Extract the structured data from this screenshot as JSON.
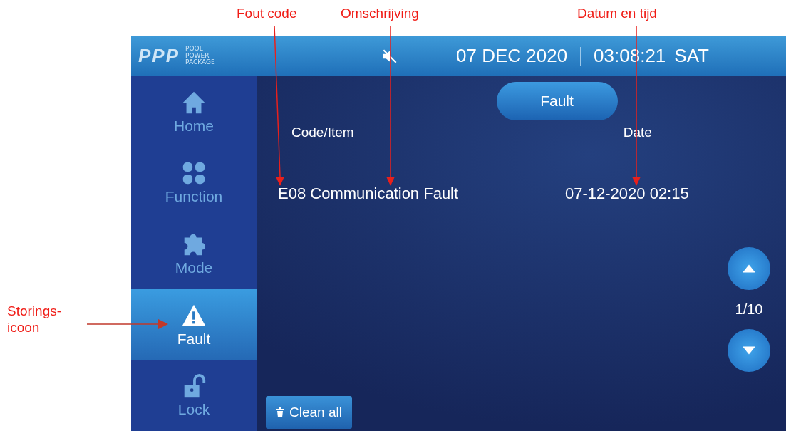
{
  "annotations": [
    {
      "kind": "top",
      "label": "Fout code"
    },
    {
      "kind": "top",
      "label": "Omschrijving"
    },
    {
      "kind": "top",
      "label": "Datum en tijd"
    },
    {
      "kind": "left",
      "label": "Storings-\nicoon"
    }
  ],
  "header": {
    "logo": "PPP",
    "logo_subtitle": "POOL POWER PACKAGE",
    "sound_muted": true,
    "date": "07 DEC 2020",
    "time": "03:08:21",
    "weekday": "SAT"
  },
  "sidebar": {
    "items": [
      {
        "kind": "home",
        "label": "Home",
        "selected": false
      },
      {
        "kind": "function",
        "label": "Function",
        "selected": false
      },
      {
        "kind": "mode",
        "label": "Mode",
        "selected": false
      },
      {
        "kind": "fault",
        "label": "Fault",
        "selected": true
      },
      {
        "kind": "lock",
        "label": "Lock",
        "selected": false
      }
    ]
  },
  "panel": {
    "title": "Fault",
    "columns": [
      "Code/Item",
      "Date"
    ],
    "rows": [
      {
        "code_item": "E08 Communication Fault",
        "date": "07-12-2020 02:15"
      }
    ],
    "page": "1/10",
    "clean_button": "Clean all"
  }
}
